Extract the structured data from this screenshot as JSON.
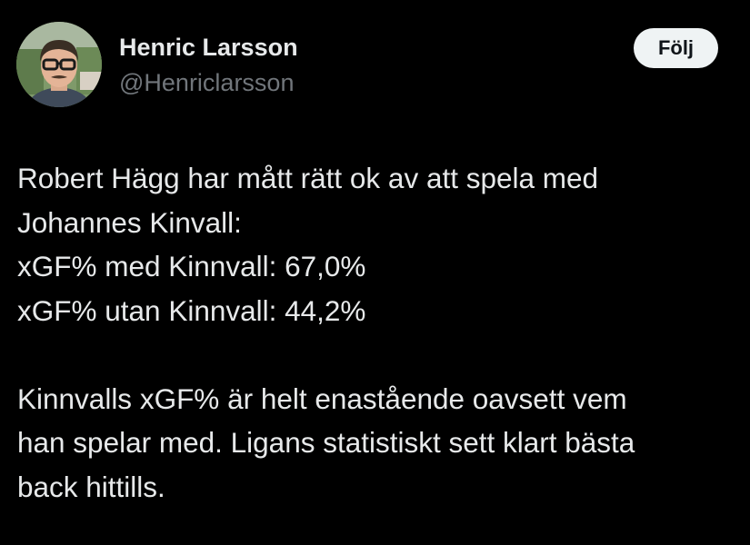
{
  "author": {
    "display_name": "Henric Larsson",
    "handle": "@Henriclarsson",
    "avatar_icon": "profile-photo"
  },
  "follow_button": {
    "label": "Följ"
  },
  "tweet": {
    "paragraph1_lines": [
      "Robert Hägg har mått rätt ok av att spela med",
      "Johannes Kinvall:",
      "xGF% med Kinnvall: 67,0%",
      "xGF% utan Kinnvall: 44,2%"
    ],
    "paragraph2_lines": [
      "Kinnvalls xGF% är helt enastående oavsett vem",
      "han spelar med. Ligans statistiskt sett klart bästa",
      "back hittills."
    ]
  },
  "colors": {
    "background": "#000000",
    "primary_text": "#e7e9ea",
    "secondary_text": "#71767b",
    "button_bg": "#eff3f4",
    "button_text": "#0f1419"
  }
}
